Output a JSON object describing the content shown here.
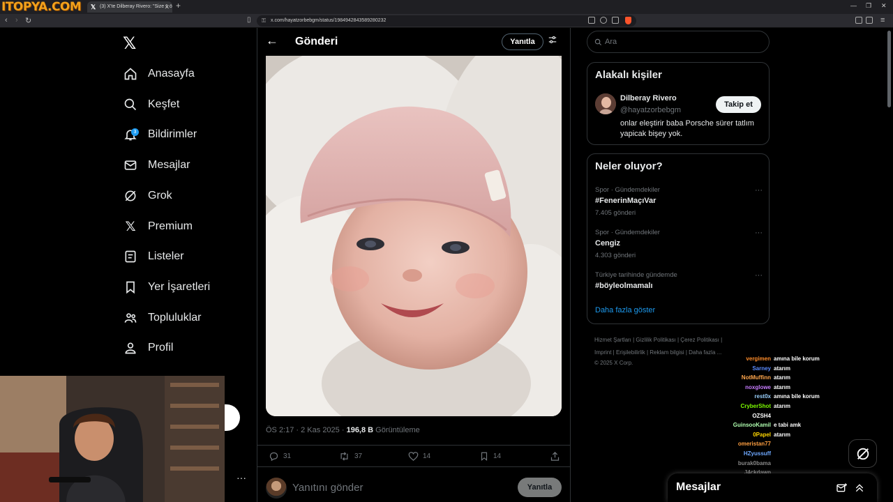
{
  "browser": {
    "logo_text": "ITOPYA.COM",
    "tab_title": "(3) X'te Dilberay Rivero: \"Size 1 ö",
    "url": "x.com/hayatzorbebgm/status/1984942843589280232",
    "icons": [
      "back-icon",
      "forward-icon",
      "reload-icon",
      "bookmark-icon",
      "lock-icon",
      "brave-shield-icon",
      "minimize-icon",
      "maximize-icon",
      "close-icon"
    ]
  },
  "nav": {
    "items": [
      {
        "label": "Anasayfa",
        "icon": "home-icon"
      },
      {
        "label": "Keşfet",
        "icon": "search-icon"
      },
      {
        "label": "Bildirimler",
        "icon": "bell-icon",
        "badge": "3"
      },
      {
        "label": "Mesajlar",
        "icon": "mail-icon"
      },
      {
        "label": "Grok",
        "icon": "grok-icon"
      },
      {
        "label": "Premium",
        "icon": "x-icon"
      },
      {
        "label": "Listeler",
        "icon": "list-icon"
      },
      {
        "label": "Yer İşaretleri",
        "icon": "bookmark-icon"
      },
      {
        "label": "Topluluklar",
        "icon": "people-icon"
      },
      {
        "label": "Profil",
        "icon": "person-icon"
      }
    ]
  },
  "post": {
    "header_title": "Gönderi",
    "reply_pill": "Yanıtla",
    "time": "ÖS 2:17 · 2 Kas 2025 · ",
    "views": "196,8 B",
    "views_label": " Görüntüleme",
    "replies": "31",
    "reposts": "37",
    "likes": "14",
    "bookmarks": "14",
    "compose_placeholder": "Yanıtını gönder",
    "compose_button": "Yanıtla"
  },
  "sidebar": {
    "search_placeholder": "Ara",
    "related_title": "Alakalı kişiler",
    "person": {
      "name": "Dilberay Rivero",
      "handle": "@hayatzorbebgm",
      "bio": "onlar eleştirir baba Porsche sürer tatlım yapicak bişey yok.",
      "follow_label": "Takip et"
    },
    "trends_title": "Neler oluyor?",
    "trends": [
      {
        "context": "Spor · Gündemdekiler",
        "name": "#FenerinMaçıVar",
        "count": "7.405 gönderi"
      },
      {
        "context": "Spor · Gündemdekiler",
        "name": "Cengiz",
        "count": "4.303 gönderi"
      },
      {
        "context": "Türkiye tarihinde gündemde",
        "name": "#böyleolmamalı",
        "count": ""
      }
    ],
    "show_more": "Daha fazla göster",
    "footer_row1": "Hizmet Şartları  |  Gizlilik Politikası  |  Çerez Politikası  |",
    "footer_row2": "Imprint  |  Erişilebilirlik  |  Reklam bilgisi  |  Daha fazla ...",
    "footer_row3": "© 2025 X Corp."
  },
  "chat": [
    {
      "user": "vergimen",
      "msg": "amına bile korum",
      "color": "#ff8c2a"
    },
    {
      "user": "Sarney",
      "msg": "atarım",
      "color": "#5b8cff"
    },
    {
      "user": "NotMuffinn",
      "msg": "atarım",
      "color": "#ffa64d"
    },
    {
      "user": "noxglowe",
      "msg": "atarım",
      "color": "#c77dff"
    },
    {
      "user": "rest0x",
      "msg": "amına bile korum",
      "color": "#9ad1ff"
    },
    {
      "user": "CryberShot",
      "msg": "atarım",
      "color": "#7CFC00"
    },
    {
      "user": "OZSH4",
      "msg": "",
      "color": "#ffffff"
    },
    {
      "user": "GuinsooKamil",
      "msg": "e tabi amk",
      "color": "#b0ffb0"
    },
    {
      "user": "0Papel",
      "msg": "atarım",
      "color": "#ffd700"
    },
    {
      "user": "omeristan77",
      "msg": "",
      "color": "#ff9f40"
    },
    {
      "user": "HZyussuff",
      "msg": "",
      "color": "#6ea8ff"
    },
    {
      "user": "burak0bama",
      "msg": "",
      "color": "#888888"
    },
    {
      "user": "J4ckdawn",
      "msg": "",
      "color": "#777777"
    }
  ],
  "messages_bar": {
    "title": "Mesajlar"
  },
  "colors": {
    "accent": "#1d9bf0",
    "bg": "#000000",
    "border": "#2f3336",
    "muted": "#71767b"
  }
}
